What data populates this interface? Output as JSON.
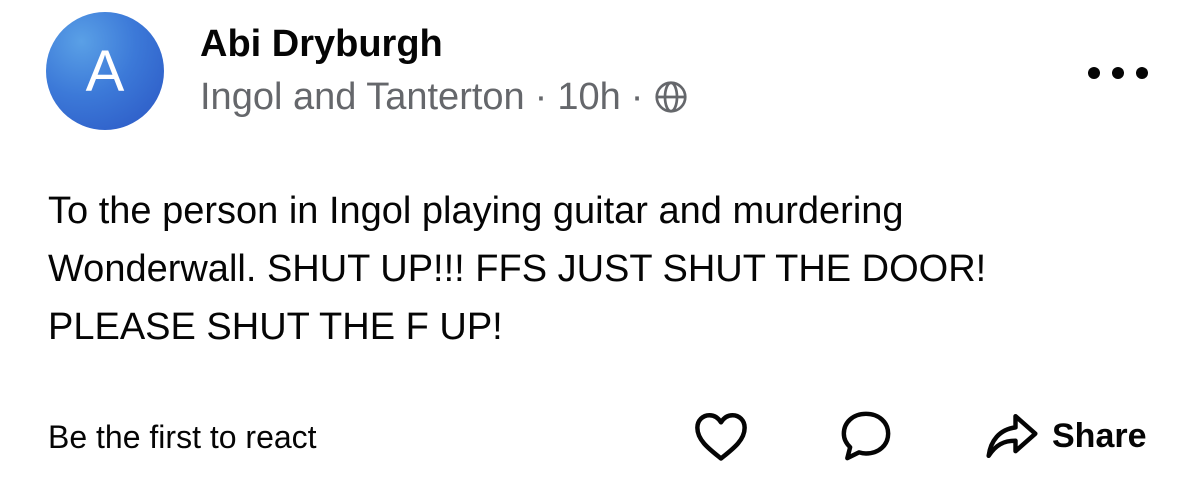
{
  "post": {
    "author": {
      "avatar_letter": "A",
      "name": "Abi Dryburgh"
    },
    "meta": {
      "group": "Ingol and Tanterton",
      "separator": "·",
      "time": "10h",
      "audience_icon": "globe-icon"
    },
    "more_icon": "more-dots-icon",
    "text": "To the person in Ingol playing guitar and murdering\nWonderwall. SHUT UP!!! FFS JUST SHUT THE DOOR!\nPLEASE SHUT THE F UP!",
    "reactions_summary": "Be the first to react",
    "actions": {
      "like_icon": "heart-icon",
      "comment_icon": "comment-icon",
      "share_icon": "share-arrow-icon",
      "share_label": "Share"
    }
  },
  "colors": {
    "avatar": "#3c79d8",
    "text": "#050505",
    "meta": "#65676b",
    "background": "#ffffff"
  }
}
